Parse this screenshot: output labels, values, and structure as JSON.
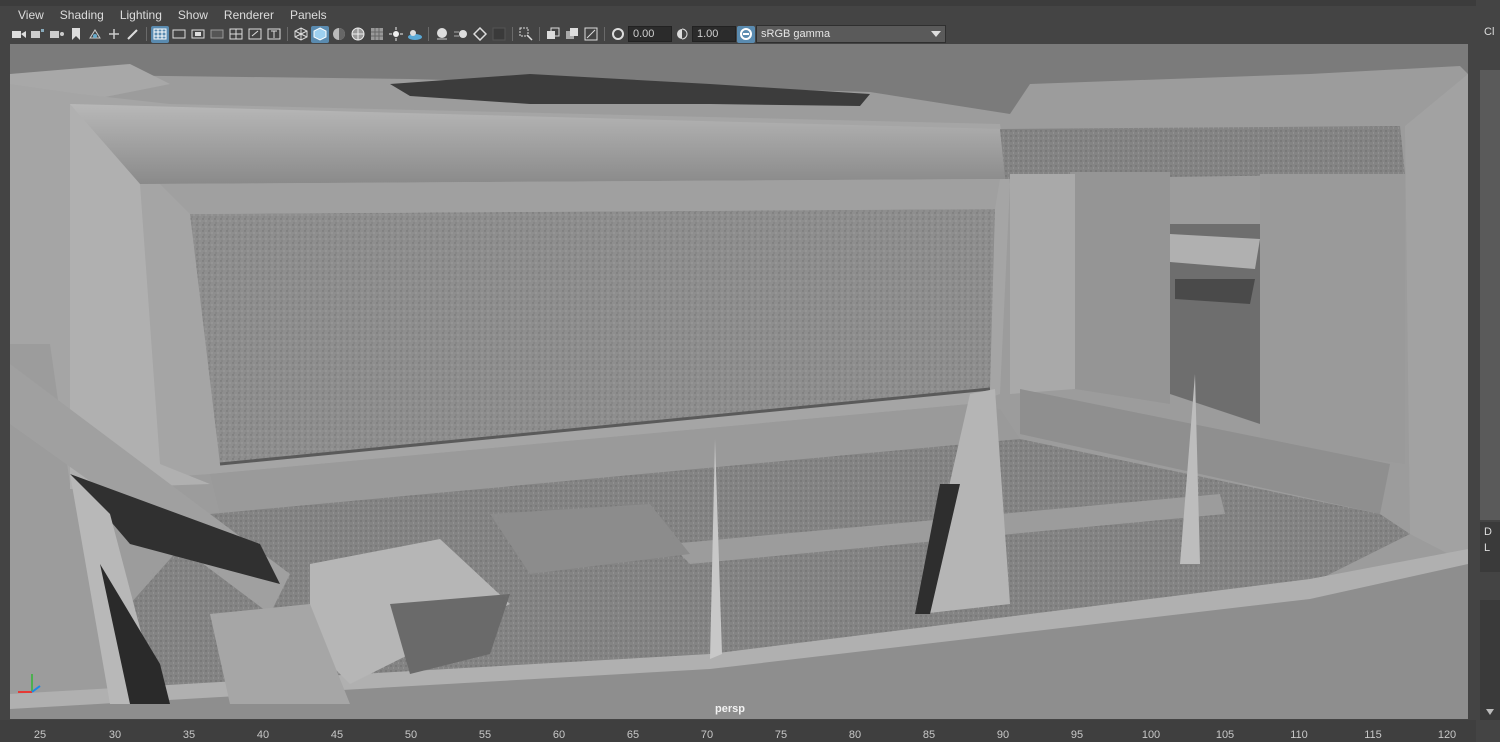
{
  "menu": [
    "View",
    "Shading",
    "Lighting",
    "Show",
    "Renderer",
    "Panels"
  ],
  "toolbar": {
    "exposure_value": "0.00",
    "gamma_value": "1.00",
    "colorspace": "sRGB gamma"
  },
  "viewport": {
    "camera_label": "persp"
  },
  "right_panel": {
    "top_text": "Cl",
    "mid_text_1": "D",
    "mid_text_2": "L"
  },
  "timeline": {
    "ticks": [
      "25",
      "30",
      "35",
      "40",
      "45",
      "50",
      "55",
      "60",
      "65",
      "70",
      "75",
      "80",
      "85",
      "90",
      "95",
      "100",
      "105",
      "110",
      "115",
      "120"
    ]
  },
  "colors": {
    "accent": "#5a8bb0",
    "viewport_bg": "#808080",
    "ui_bg": "#444444"
  }
}
